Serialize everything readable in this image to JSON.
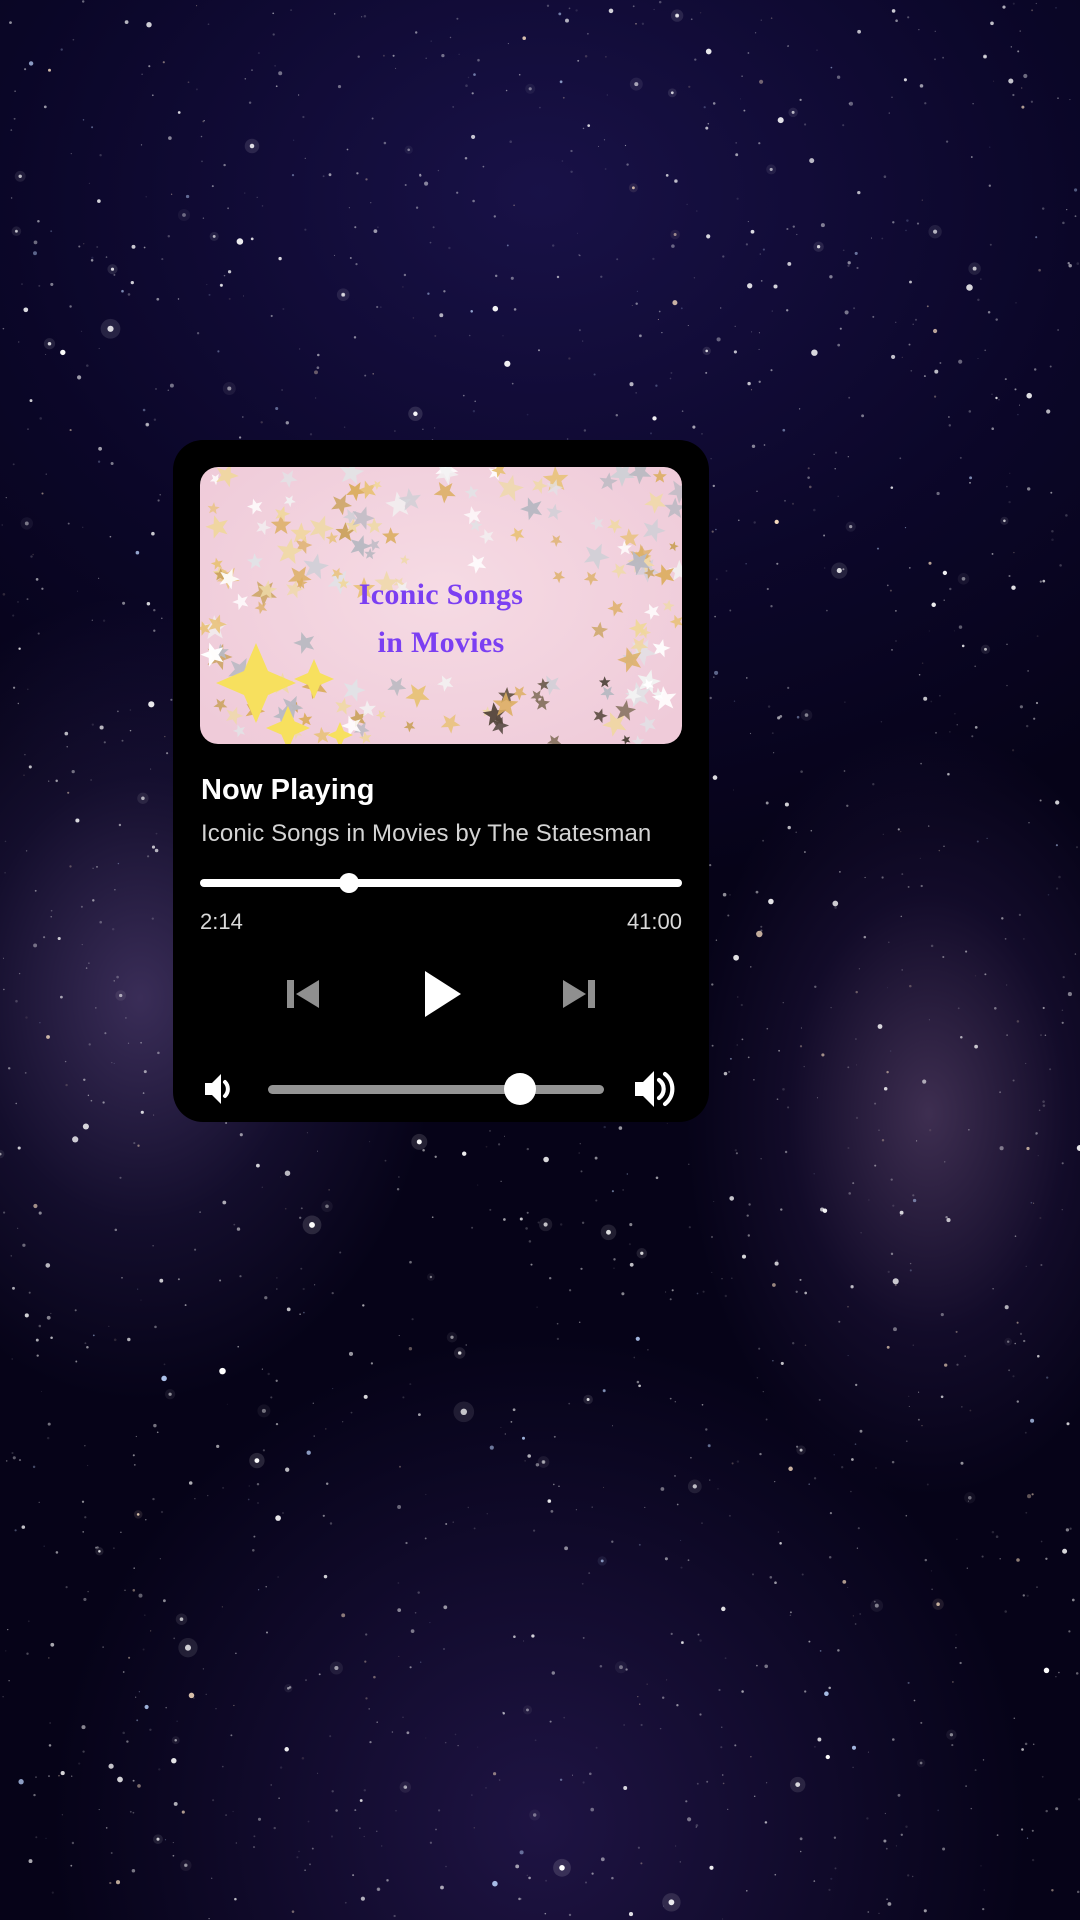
{
  "background": {
    "name": "starry-galaxy-night-sky",
    "base_color": "#120b33",
    "star_color": "#ffffff"
  },
  "player": {
    "card_background": "#000000",
    "album_art": {
      "background_color": "#f1cfdb",
      "title_color": "#7b3ff2",
      "title_line_1": "Iconic Songs",
      "title_line_2": "in Movies",
      "decoration": "gold-and-silver-confetti-stars"
    },
    "heading": "Now Playing",
    "subtitle": "Iconic Songs in Movies by The Statesman",
    "progress": {
      "percent": 31,
      "current_time": "2:14",
      "total_time": "41:00",
      "track_color": "#ffffff",
      "thumb_color": "#ffffff"
    },
    "controls": {
      "previous_label": "previous-track",
      "play_label": "play",
      "next_label": "next-track",
      "inactive_color": "#8f8f8f",
      "active_color": "#ffffff"
    },
    "volume": {
      "percent": 75,
      "mute_icon_label": "volume-low",
      "max_icon_label": "volume-high",
      "track_color": "#949494",
      "thumb_color": "#ffffff"
    }
  }
}
